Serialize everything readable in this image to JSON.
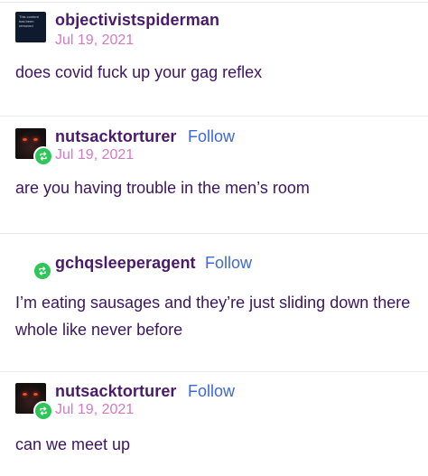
{
  "colors": {
    "username": "#4a1a6b",
    "follow": "#3d68d8",
    "date": "#d37ac1",
    "body": "#3c1562",
    "reblog_badge": "#2ec55a",
    "divider": "#ebebeb"
  },
  "posts": [
    {
      "username": "objectivistspiderman",
      "date": "Jul 19, 2021",
      "body": "does covid fuck up your gag reflex",
      "avatar_icon": "content-removed-avatar",
      "avatar_text": "This content has been removed"
    },
    {
      "username": "nutsacktorturer",
      "follow_label": "Follow",
      "date": "Jul 19, 2021",
      "body": "are you having trouble in the men’s room",
      "avatar_icon": "red-eyes-avatar",
      "badge_icon": "reblog-icon"
    },
    {
      "username": "gchqsleeperagent",
      "follow_label": "Follow",
      "body": "I’m eating sausages and they’re just sliding down there whole like never before",
      "badge_icon": "reblog-icon"
    },
    {
      "username": "nutsacktorturer",
      "follow_label": "Follow",
      "date": "Jul 19, 2021",
      "body": "can we meet up",
      "avatar_icon": "red-eyes-avatar",
      "badge_icon": "reblog-icon"
    }
  ]
}
